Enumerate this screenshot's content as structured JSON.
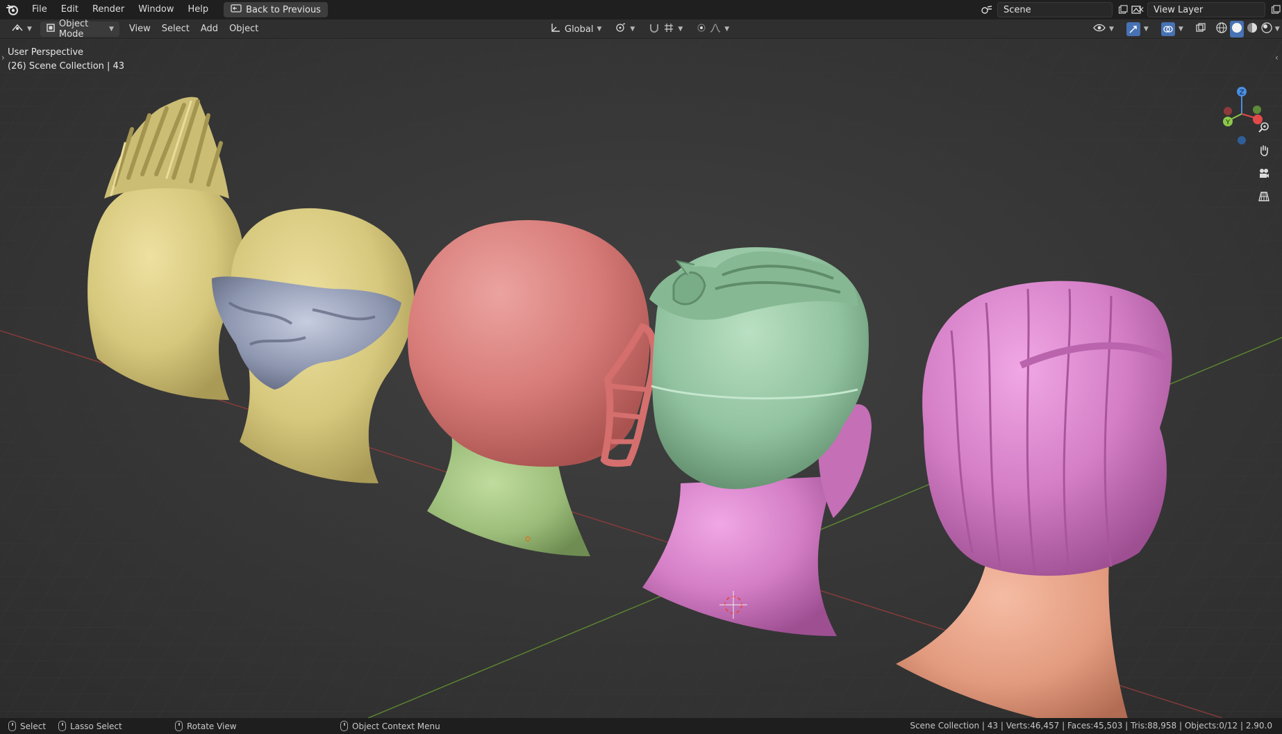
{
  "menubar": {
    "items": [
      "File",
      "Edit",
      "Render",
      "Window",
      "Help"
    ],
    "back_button": "Back to Previous",
    "scene_name": "Scene",
    "view_layer_name": "View Layer"
  },
  "header": {
    "mode": "Object Mode",
    "menus": [
      "View",
      "Select",
      "Add",
      "Object"
    ],
    "transform_orientation": "Global"
  },
  "viewport": {
    "perspective_label": "User Perspective",
    "collection_label": "(26) Scene Collection | 43",
    "gizmo": {
      "z": "Z",
      "y": "Y"
    }
  },
  "statusbar": {
    "select": "Select",
    "lasso": "Lasso Select",
    "rotate": "Rotate View",
    "context": "Object Context Menu",
    "stats": "Scene Collection | 43 | Verts:46,457 | Faces:45,503 | Tris:88,958 | Objects:0/12 | 2.90.0"
  },
  "colors": {
    "yellow_head": "#d6c87c",
    "red_helmet": "#d77b78",
    "green_neck": "#9cbd7a",
    "mint_head": "#91c29f",
    "pink_hair": "#d47ec6",
    "salmon_neck": "#e29a7e",
    "grey_beard": "#8e97b0"
  }
}
